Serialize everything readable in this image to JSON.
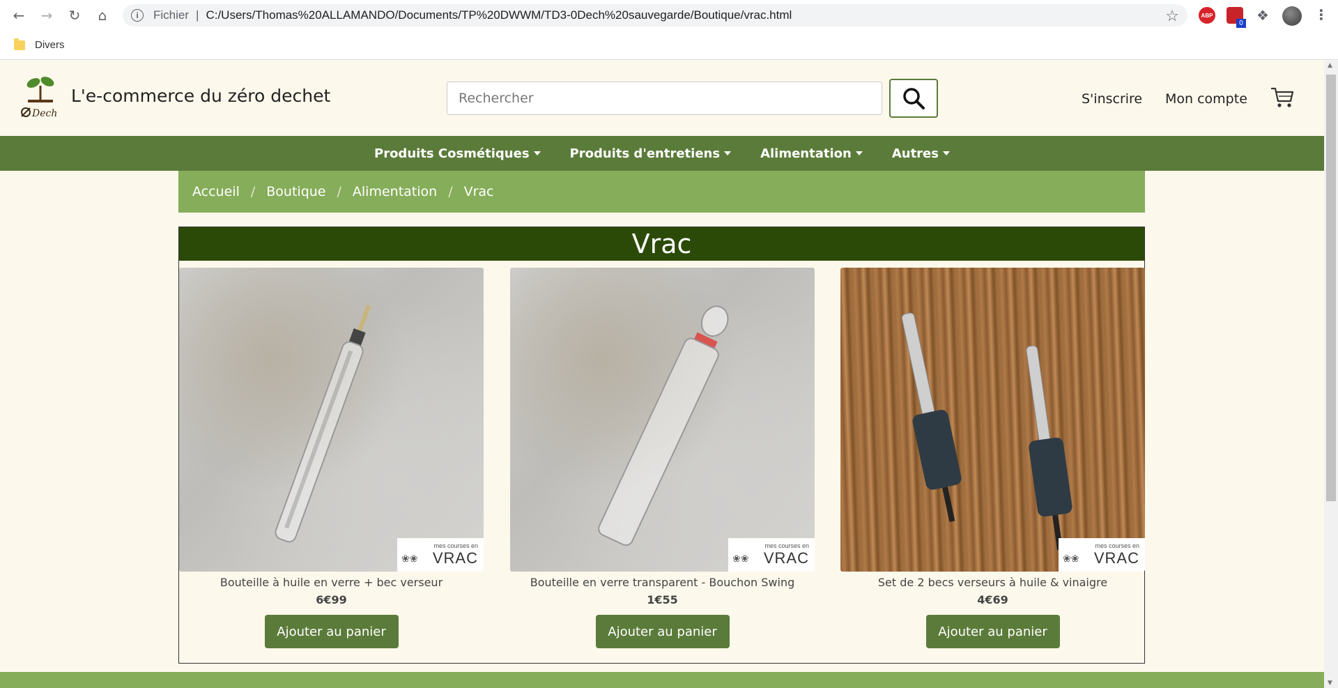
{
  "browser": {
    "scheme": "Fichier",
    "url": "C:/Users/Thomas%20ALLAMANDO/Documents/TP%20DWWM/TD3-0Dech%20sauvegarde/Boutique/vrac.html",
    "abp_label": "ABP",
    "ext_badge": "0",
    "bookmarks": [
      {
        "label": "Divers"
      }
    ]
  },
  "header": {
    "title": "L'e-commerce du zéro dechet",
    "search_placeholder": "Rechercher",
    "links": {
      "signup": "S'inscrire",
      "account": "Mon compte"
    }
  },
  "nav": {
    "items": [
      {
        "label": "Produits Cosmétiques"
      },
      {
        "label": "Produits d'entretiens"
      },
      {
        "label": "Alimentation"
      },
      {
        "label": "Autres"
      }
    ]
  },
  "breadcrumb": [
    "Accueil",
    "Boutique",
    "Alimentation",
    "Vrac"
  ],
  "section": {
    "title": "Vrac",
    "brand_small": "mes courses en",
    "brand_big": "VRAC",
    "add_label": "Ajouter au panier",
    "products": [
      {
        "name": "Bouteille à huile en verre + bec verseur",
        "price": "6€99"
      },
      {
        "name": "Bouteille en verre transparent - Bouchon Swing",
        "price": "1€55"
      },
      {
        "name": "Set de 2 becs verseurs à huile & vinaigre",
        "price": "4€69"
      }
    ]
  },
  "colors": {
    "nav_green": "#5b7b3a",
    "light_green": "#86ad5a",
    "dark_green": "#2b4a08",
    "page_bg": "#fdf8ec"
  }
}
